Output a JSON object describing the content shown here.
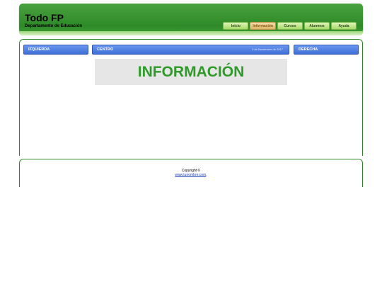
{
  "header": {
    "title": "Todo FP",
    "subtitle": "Departamento de Educación"
  },
  "nav": {
    "items": [
      {
        "label": "Inicio",
        "active": false
      },
      {
        "label": "Información",
        "active": true
      },
      {
        "label": "Cursos",
        "active": false
      },
      {
        "label": "Alumnos",
        "active": false
      },
      {
        "label": "Ayuda",
        "active": false
      }
    ]
  },
  "columns": {
    "left": {
      "title": "IZQUIERDA"
    },
    "center": {
      "title": "CENTRO",
      "date": "2 de Noviembre de 2017"
    },
    "right": {
      "title": "DERECHA"
    }
  },
  "main": {
    "heading": "INFORMACIÓN"
  },
  "footer": {
    "copyright": "Copyright ©",
    "link_text": "www.tunombre.com",
    "link_suffix": "."
  },
  "colors": {
    "header_green": "#2e8a28",
    "bar_blue": "#3f6fd6",
    "heading_green": "#2f9a2a",
    "active_nav": "#d9b56a"
  }
}
